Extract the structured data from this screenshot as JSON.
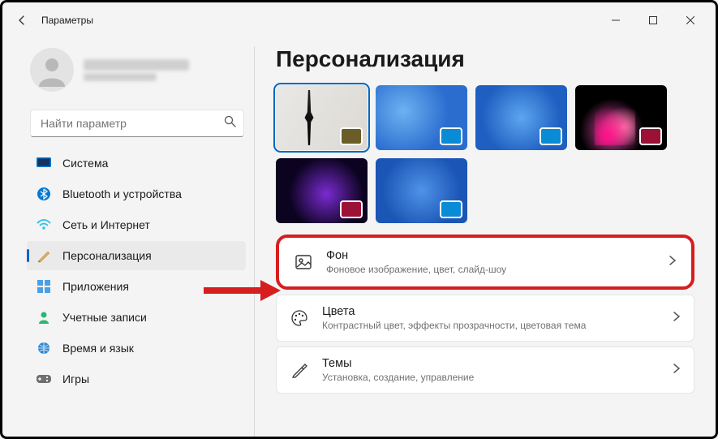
{
  "window": {
    "title": "Параметры"
  },
  "user": {
    "name_blur": "Александр Солов",
    "email_blur": "gmqw@lf@llu"
  },
  "search": {
    "placeholder": "Найти параметр"
  },
  "sidebar": {
    "items": [
      {
        "label": "Система",
        "icon": "system"
      },
      {
        "label": "Bluetooth и устройства",
        "icon": "bluetooth"
      },
      {
        "label": "Сеть и Интернет",
        "icon": "network"
      },
      {
        "label": "Персонализация",
        "icon": "personalization",
        "active": true
      },
      {
        "label": "Приложения",
        "icon": "apps"
      },
      {
        "label": "Учетные записи",
        "icon": "accounts"
      },
      {
        "label": "Время и язык",
        "icon": "time-language"
      },
      {
        "label": "Игры",
        "icon": "gaming"
      }
    ]
  },
  "main": {
    "title": "Персонализация",
    "themes": [
      {
        "swatch": "#6b5d27",
        "selected": true
      },
      {
        "swatch": "#0a8bd6"
      },
      {
        "swatch": "#0a8bd6"
      },
      {
        "swatch": "#9c1236"
      },
      {
        "swatch": "#9c1236"
      },
      {
        "swatch": "#0a8bd6"
      }
    ],
    "settings": [
      {
        "title": "Фон",
        "desc": "Фоновое изображение, цвет, слайд-шоу",
        "icon": "image",
        "highlight": true
      },
      {
        "title": "Цвета",
        "desc": "Контрастный цвет, эффекты прозрачности, цветовая тема",
        "icon": "palette"
      },
      {
        "title": "Темы",
        "desc": "Установка, создание, управление",
        "icon": "brush"
      }
    ]
  }
}
